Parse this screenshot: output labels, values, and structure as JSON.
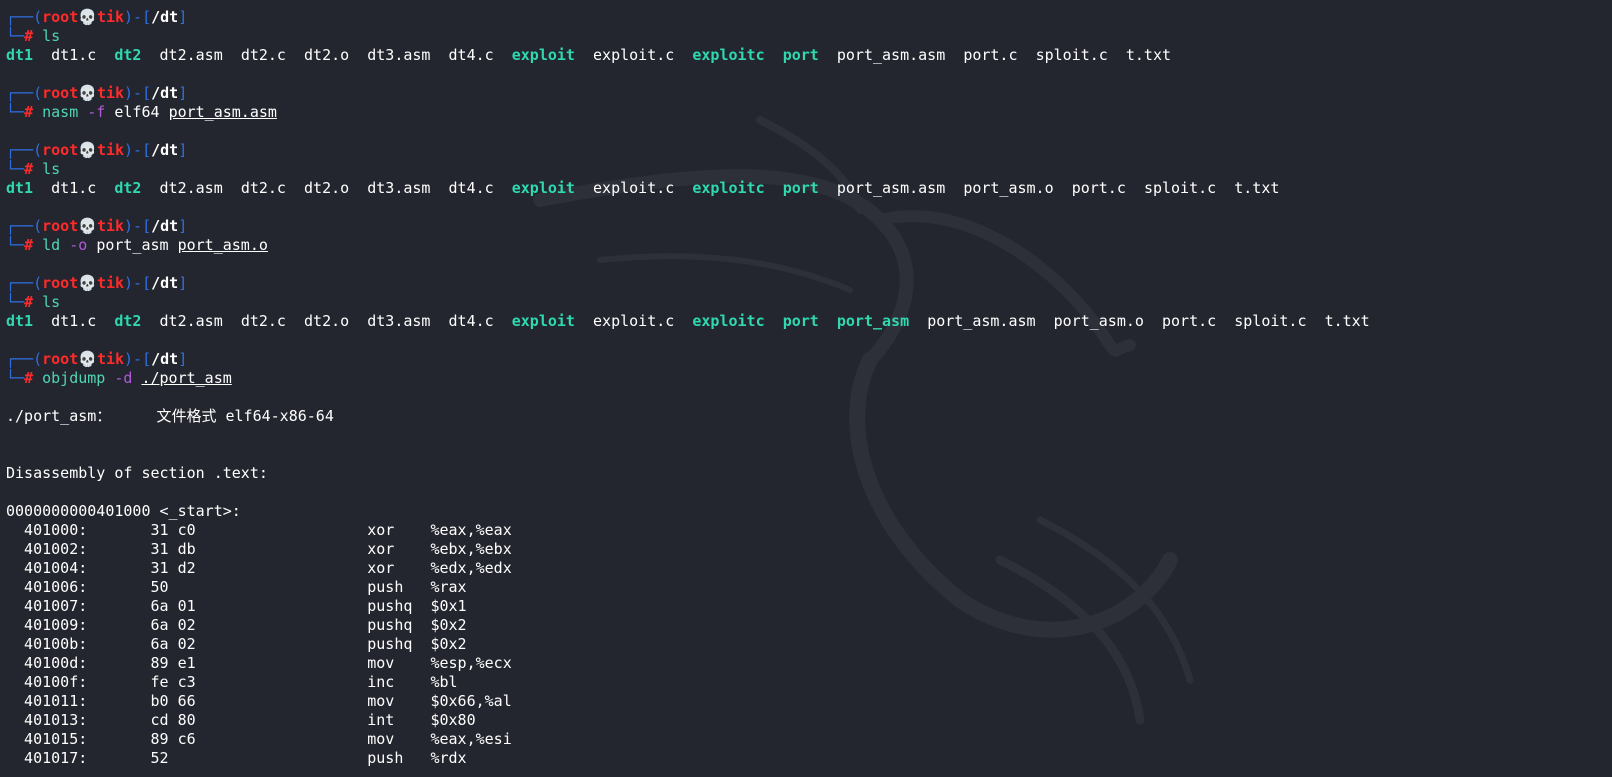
{
  "prompt": {
    "user": "root",
    "host": "tik",
    "skull": "💀",
    "cwd": "/dt",
    "frame_open": "┌──(",
    "frame_mid": ")-[",
    "frame_close": "]",
    "frame_low": "└─",
    "hash": "#"
  },
  "blocks": [
    {
      "cmd": "ls",
      "opts": [],
      "args": [],
      "output_type": "files",
      "files": [
        {
          "name": "dt1",
          "exec": true
        },
        {
          "name": "dt1.c",
          "exec": false
        },
        {
          "name": "dt2",
          "exec": true
        },
        {
          "name": "dt2.asm",
          "exec": false
        },
        {
          "name": "dt2.c",
          "exec": false
        },
        {
          "name": "dt2.o",
          "exec": false
        },
        {
          "name": "dt3.asm",
          "exec": false
        },
        {
          "name": "dt4.c",
          "exec": false
        },
        {
          "name": "exploit",
          "exec": true
        },
        {
          "name": "exploit.c",
          "exec": false
        },
        {
          "name": "exploitc",
          "exec": true
        },
        {
          "name": "port",
          "exec": true
        },
        {
          "name": "port_asm.asm",
          "exec": false
        },
        {
          "name": "port.c",
          "exec": false
        },
        {
          "name": "sploit.c",
          "exec": false
        },
        {
          "name": "t.txt",
          "exec": false
        }
      ]
    },
    {
      "cmd": "nasm",
      "line": [
        {
          "t": "opt",
          "v": "-f"
        },
        {
          "t": "arg",
          "v": "elf64"
        },
        {
          "t": "path",
          "v": "port_asm.asm"
        }
      ],
      "output_type": "none"
    },
    {
      "cmd": "ls",
      "line": [],
      "output_type": "files",
      "files": [
        {
          "name": "dt1",
          "exec": true
        },
        {
          "name": "dt1.c",
          "exec": false
        },
        {
          "name": "dt2",
          "exec": true
        },
        {
          "name": "dt2.asm",
          "exec": false
        },
        {
          "name": "dt2.c",
          "exec": false
        },
        {
          "name": "dt2.o",
          "exec": false
        },
        {
          "name": "dt3.asm",
          "exec": false
        },
        {
          "name": "dt4.c",
          "exec": false
        },
        {
          "name": "exploit",
          "exec": true
        },
        {
          "name": "exploit.c",
          "exec": false
        },
        {
          "name": "exploitc",
          "exec": true
        },
        {
          "name": "port",
          "exec": true
        },
        {
          "name": "port_asm.asm",
          "exec": false
        },
        {
          "name": "port_asm.o",
          "exec": false
        },
        {
          "name": "port.c",
          "exec": false
        },
        {
          "name": "sploit.c",
          "exec": false
        },
        {
          "name": "t.txt",
          "exec": false
        }
      ]
    },
    {
      "cmd": "ld",
      "line": [
        {
          "t": "opt",
          "v": "-o"
        },
        {
          "t": "arg",
          "v": "port_asm"
        },
        {
          "t": "path",
          "v": "port_asm.o"
        }
      ],
      "output_type": "none"
    },
    {
      "cmd": "ls",
      "line": [],
      "output_type": "files",
      "files": [
        {
          "name": "dt1",
          "exec": true
        },
        {
          "name": "dt1.c",
          "exec": false
        },
        {
          "name": "dt2",
          "exec": true
        },
        {
          "name": "dt2.asm",
          "exec": false
        },
        {
          "name": "dt2.c",
          "exec": false
        },
        {
          "name": "dt2.o",
          "exec": false
        },
        {
          "name": "dt3.asm",
          "exec": false
        },
        {
          "name": "dt4.c",
          "exec": false
        },
        {
          "name": "exploit",
          "exec": true
        },
        {
          "name": "exploit.c",
          "exec": false
        },
        {
          "name": "exploitc",
          "exec": true
        },
        {
          "name": "port",
          "exec": true
        },
        {
          "name": "port_asm",
          "exec": true
        },
        {
          "name": "port_asm.asm",
          "exec": false
        },
        {
          "name": "port_asm.o",
          "exec": false
        },
        {
          "name": "port.c",
          "exec": false
        },
        {
          "name": "sploit.c",
          "exec": false
        },
        {
          "name": "t.txt",
          "exec": false
        }
      ]
    },
    {
      "cmd": "objdump",
      "line": [
        {
          "t": "opt",
          "v": "-d"
        },
        {
          "t": "path",
          "v": "./port_asm"
        }
      ],
      "output_type": "text",
      "text_lines": [
        "",
        "./port_asm：     文件格式 elf64-x86-64",
        "",
        "",
        "Disassembly of section .text:",
        "",
        "0000000000401000 <_start>:",
        "  401000:\t31 c0                \txor    %eax,%eax",
        "  401002:\t31 db                \txor    %ebx,%ebx",
        "  401004:\t31 d2                \txor    %edx,%edx",
        "  401006:\t50                   \tpush   %rax",
        "  401007:\t6a 01                \tpushq  $0x1",
        "  401009:\t6a 02                \tpushq  $0x2",
        "  40100b:\t6a 02                \tpushq  $0x2",
        "  40100d:\t89 e1                \tmov    %esp,%ecx",
        "  40100f:\tfe c3                \tinc    %bl",
        "  401011:\tb0 66                \tmov    $0x66,%al",
        "  401013:\tcd 80                \tint    $0x80",
        "  401015:\t89 c6                \tmov    %eax,%esi",
        "  401017:\t52                   \tpush   %rdx"
      ]
    }
  ]
}
